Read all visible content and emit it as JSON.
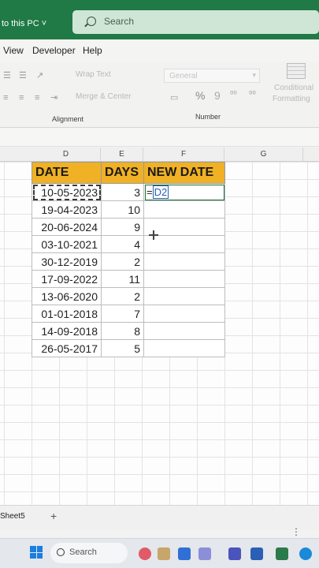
{
  "titlebar": {
    "save_location": "to this PC ˅",
    "search_label": "Search"
  },
  "ribbon_tabs": [
    "View",
    "Developer",
    "Help"
  ],
  "ribbon": {
    "wrap_text": "Wrap Text",
    "merge_center": "Merge & Center",
    "number_format": "General",
    "percent": "%",
    "comma": "9",
    "conditional": "Conditional",
    "formatting": "Formatting",
    "alignment_group": "Alignment",
    "number_group": "Number"
  },
  "columns": [
    "D",
    "E",
    "F",
    "G"
  ],
  "table": {
    "headers": [
      "DATE",
      "DAYS",
      "NEW DATE"
    ],
    "rows": [
      {
        "date": "10-05-2023",
        "days": "3",
        "new_date": "=D2"
      },
      {
        "date": "19-04-2023",
        "days": "10",
        "new_date": ""
      },
      {
        "date": "20-06-2024",
        "days": "9",
        "new_date": ""
      },
      {
        "date": "03-10-2021",
        "days": "4",
        "new_date": ""
      },
      {
        "date": "30-12-2019",
        "days": "2",
        "new_date": ""
      },
      {
        "date": "17-09-2022",
        "days": "11",
        "new_date": ""
      },
      {
        "date": "13-06-2020",
        "days": "2",
        "new_date": ""
      },
      {
        "date": "01-01-2018",
        "days": "7",
        "new_date": ""
      },
      {
        "date": "14-09-2018",
        "days": "8",
        "new_date": ""
      },
      {
        "date": "26-05-2017",
        "days": "5",
        "new_date": ""
      }
    ]
  },
  "formula": {
    "prefix": "=",
    "ref": "D2"
  },
  "sheet_bar": {
    "tab": "Sheet5",
    "add": "+",
    "more": "⋮"
  },
  "taskbar": {
    "search_label": "Search"
  },
  "colors": {
    "header_fill": "#f0b124",
    "excel_green": "#1f7a45"
  }
}
